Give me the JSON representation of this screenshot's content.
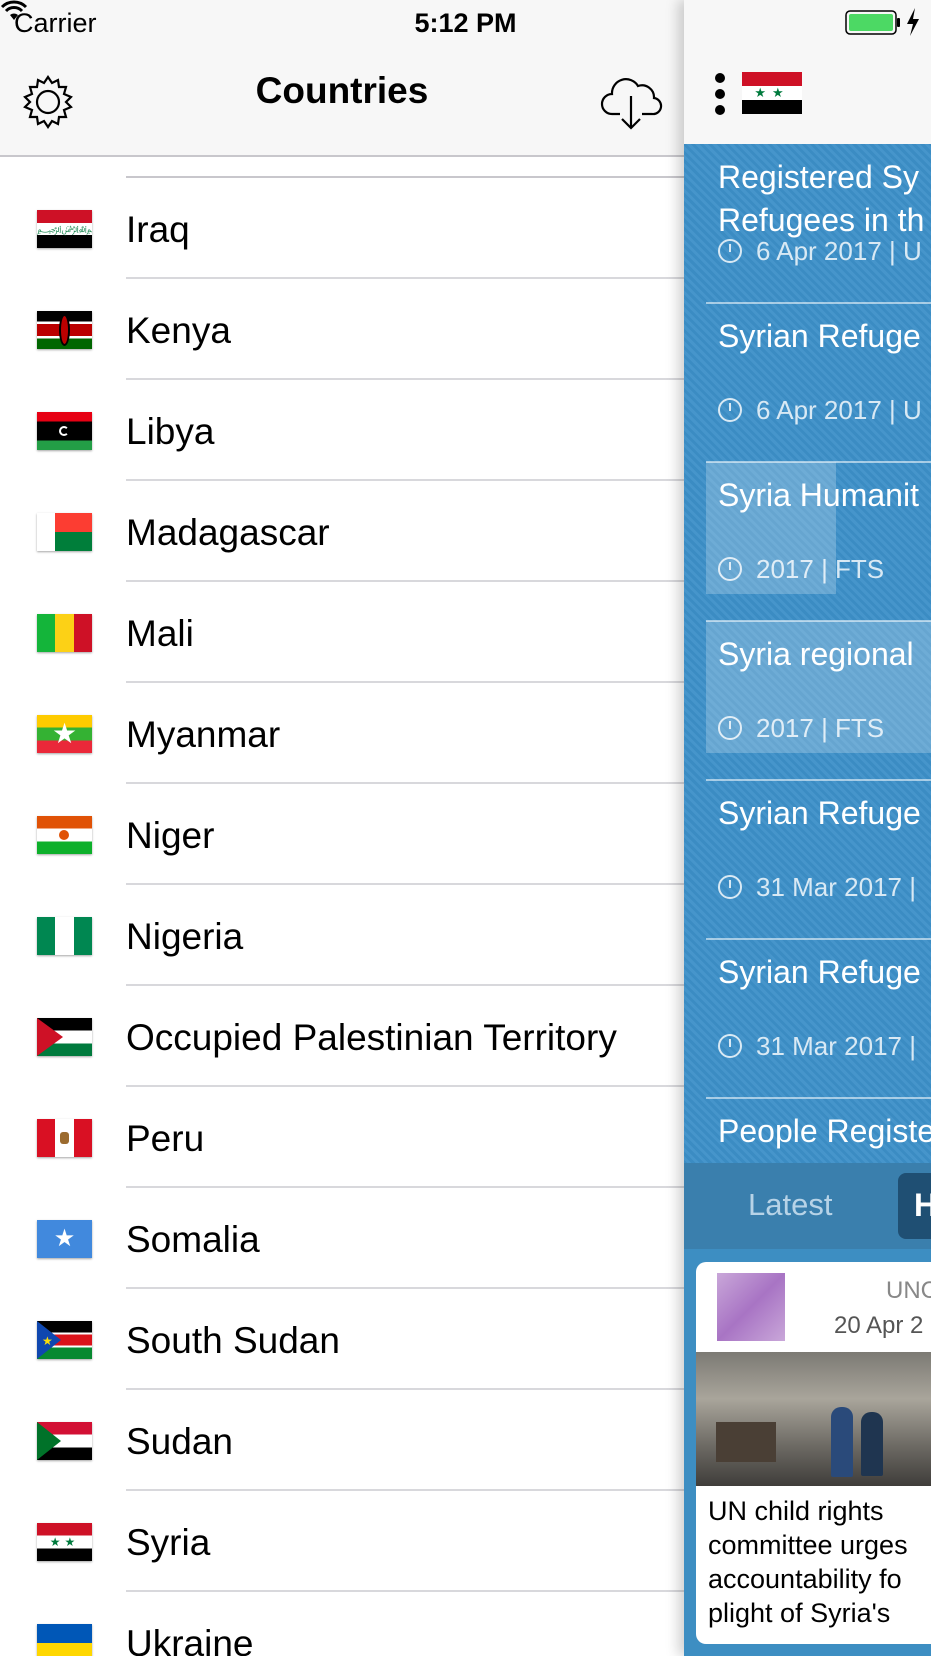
{
  "status_bar": {
    "carrier": "Carrier",
    "time": "5:12 PM"
  },
  "header": {
    "title": "Countries",
    "settings_icon": "gear-icon",
    "download_icon": "cloud-download-icon"
  },
  "countries": [
    {
      "name": "Iraq"
    },
    {
      "name": "Kenya"
    },
    {
      "name": "Libya"
    },
    {
      "name": "Madagascar"
    },
    {
      "name": "Mali"
    },
    {
      "name": "Myanmar"
    },
    {
      "name": "Niger"
    },
    {
      "name": "Nigeria"
    },
    {
      "name": "Occupied Palestinian Territory"
    },
    {
      "name": "Peru"
    },
    {
      "name": "Somalia"
    },
    {
      "name": "South Sudan"
    },
    {
      "name": "Sudan"
    },
    {
      "name": "Syria"
    },
    {
      "name": "Ukraine"
    }
  ],
  "detail": {
    "menu_icon": "more-vertical-icon",
    "feed": [
      {
        "title": "Registered Sy\nRefugees in th",
        "meta": "6 Apr 2017 | U"
      },
      {
        "title": "Syrian Refuge",
        "meta": "6 Apr 2017 | U"
      },
      {
        "title": "Syria Humanit",
        "meta": "2017 | FTS"
      },
      {
        "title": "Syria regional",
        "meta": "2017 | FTS"
      },
      {
        "title": "Syrian Refuge",
        "meta": "31 Mar 2017 |"
      },
      {
        "title": "Syrian Refuge",
        "meta": "31 Mar 2017 |"
      },
      {
        "title": "People Registe",
        "meta": ""
      }
    ],
    "tabs": {
      "latest": "Latest",
      "second": "H"
    },
    "card": {
      "source": "UNC",
      "date": "20 Apr 2",
      "headline": "UN child rights\ncommittee urges\naccountability fo\nplight of Syria's"
    }
  }
}
